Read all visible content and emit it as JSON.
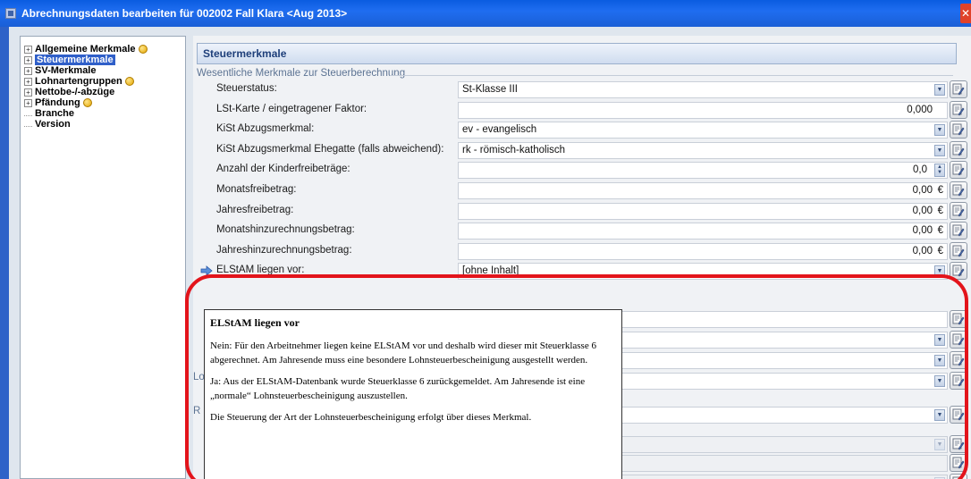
{
  "window": {
    "title": "Abrechnungsdaten bearbeiten für 002002 Fall Klara <Aug 2013>",
    "close_label": "✕"
  },
  "tree": {
    "items": [
      {
        "label": "Allgemeine Merkmale",
        "expandable": true,
        "badge": true
      },
      {
        "label": "Steuermerkmale",
        "expandable": true,
        "badge": false,
        "selected": true
      },
      {
        "label": "SV-Merkmale",
        "expandable": true,
        "badge": false
      },
      {
        "label": "Lohnartengruppen",
        "expandable": true,
        "badge": true
      },
      {
        "label": "Nettobe-/-abzüge",
        "expandable": true,
        "badge": false
      },
      {
        "label": "Pfändung",
        "expandable": true,
        "badge": true
      },
      {
        "label": "Branche",
        "expandable": false,
        "badge": false
      },
      {
        "label": "Version",
        "expandable": false,
        "badge": false
      }
    ]
  },
  "panel": {
    "header": "Steuermerkmale",
    "group_label": "Wesentliche Merkmale zur Steuerberechnung",
    "side_labels": [
      "Lo",
      "R"
    ]
  },
  "rows": [
    {
      "label": "Steuerstatus:",
      "value": "St-Klasse III",
      "kind": "dropdown"
    },
    {
      "label": "LSt-Karte / eingetragener Faktor:",
      "value": "0,000",
      "kind": "text-right"
    },
    {
      "label": "KiSt Abzugsmerkmal:",
      "value": "ev - evangelisch",
      "kind": "dropdown"
    },
    {
      "label": "KiSt Abzugsmerkmal Ehegatte (falls abweichend):",
      "value": "rk - römisch-katholisch",
      "kind": "dropdown"
    },
    {
      "label": "Anzahl der Kinderfreibeträge:",
      "value": "0,0",
      "kind": "spin"
    },
    {
      "label": "Monatsfreibetrag:",
      "value": "0,00",
      "kind": "euro"
    },
    {
      "label": "Jahresfreibetrag:",
      "value": "0,00",
      "kind": "euro"
    },
    {
      "label": "Monatshinzurechnungsbetrag:",
      "value": "0,00",
      "kind": "euro"
    },
    {
      "label": "Jahreshinzurechnungsbetrag:",
      "value": "0,00",
      "kind": "euro"
    },
    {
      "label": "ELStAM liegen vor:",
      "value": "[ohne Inhalt]",
      "kind": "dropdown",
      "arrow": true
    }
  ],
  "units": {
    "euro": "€"
  },
  "tooltip": {
    "title": "ELStAM liegen vor",
    "p1": "Nein: Für den Arbeitnehmer liegen keine ELStAM vor und deshalb wird dieser mit Steuerklasse 6 abgerechnet. Am Jahresende muss eine besondere Lohnsteuerbescheinigung ausgestellt werden.",
    "p2": "Ja: Aus der ELStAM-Datenbank wurde Steuerklasse 6 zurückgemeldet. Am Jahresende ist eine „normale“ Lohnsteuerbescheinigung auszustellen.",
    "p3": "Die Steuerung der Art der Lohnsteuerbescheinigung erfolgt über dieses Merkmal."
  },
  "colors": {
    "accent": "#2f5fc9",
    "highlight": "#e3141b"
  }
}
